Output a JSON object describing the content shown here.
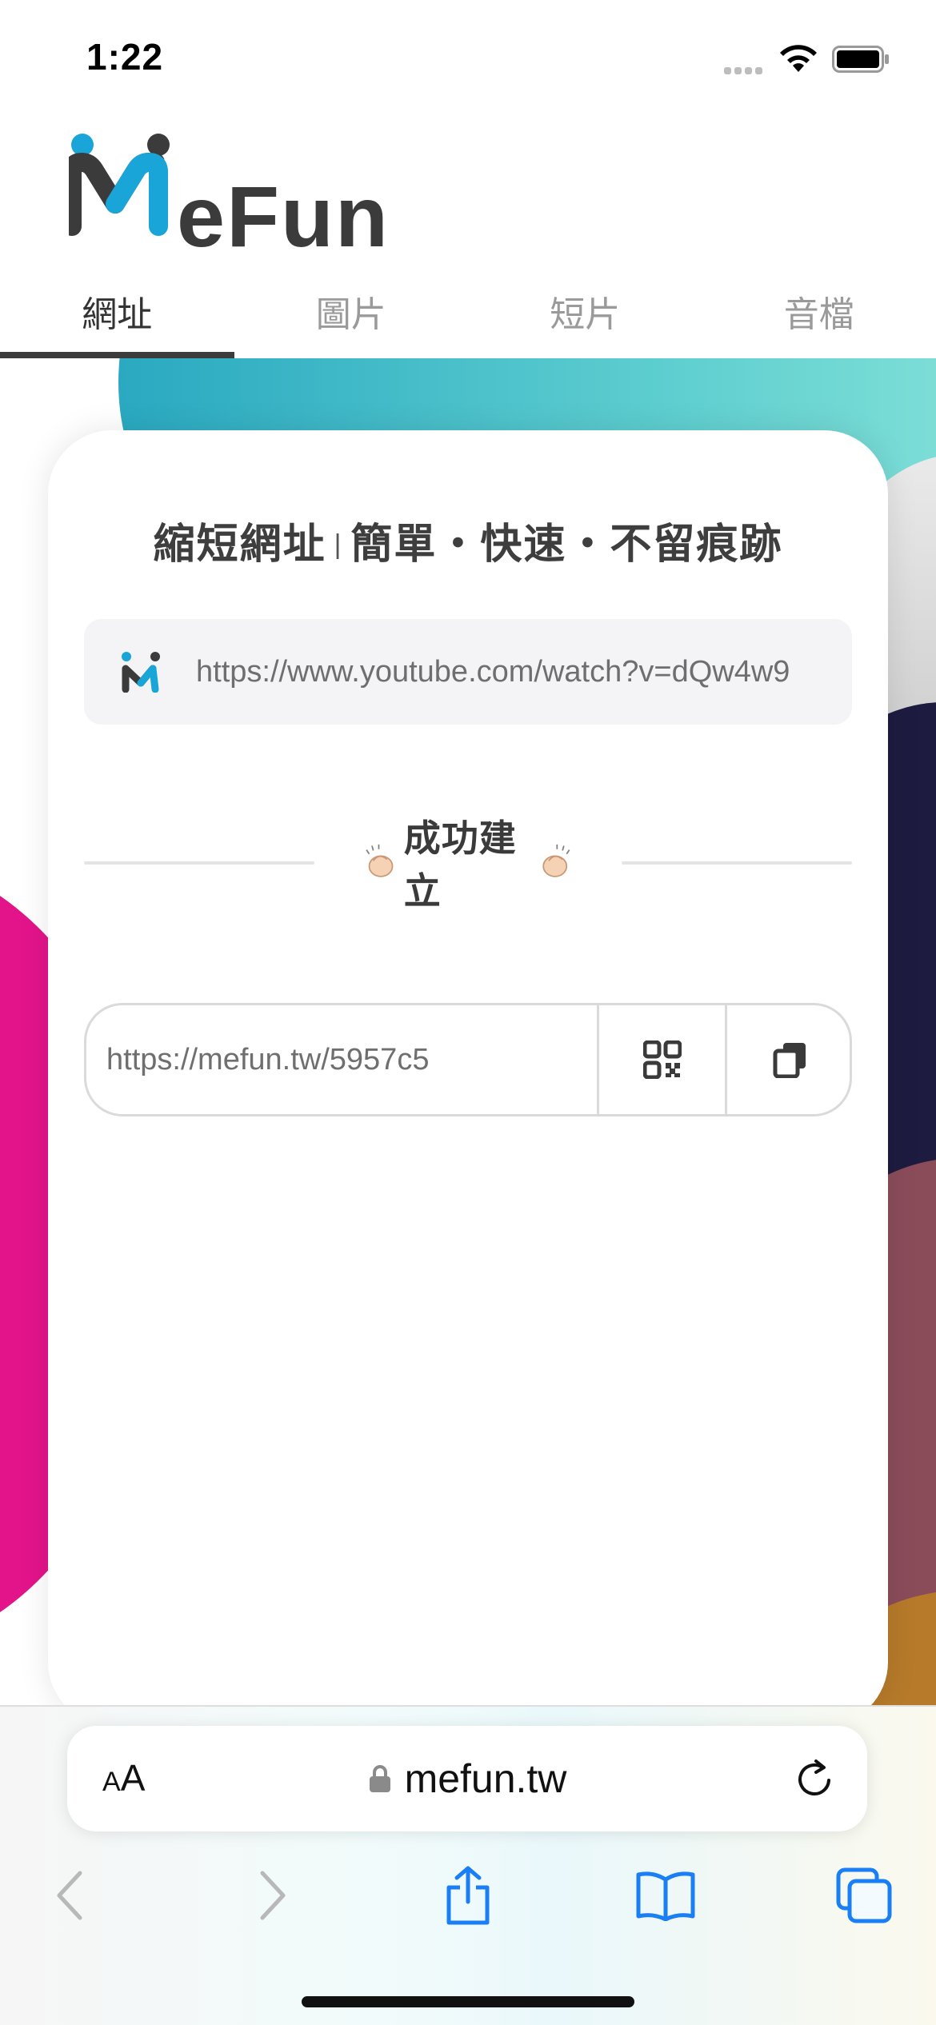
{
  "status_bar": {
    "time": "1:22"
  },
  "header": {
    "logo_text": "eFun",
    "logo_colors": {
      "accent": "#1aa5d8",
      "dark": "#3b3b3b"
    }
  },
  "tabs": [
    {
      "label": "網址",
      "active": true
    },
    {
      "label": "圖片",
      "active": false
    },
    {
      "label": "短片",
      "active": false
    },
    {
      "label": "音檔",
      "active": false
    }
  ],
  "card": {
    "title_part1": "縮短網址",
    "title_sep": "|",
    "title_part2": "簡單・快速・不留痕跡",
    "input_value": "https://www.youtube.com/watch?v=dQw4w9",
    "success_label": "成功建立",
    "success_emoji": "clapping-hands-icon",
    "short_url": "https://mefun.tw/5957c5",
    "qr_icon": "qr-code-icon",
    "copy_icon": "copy-icon"
  },
  "background_colors": {
    "teal": "#2aa9c1",
    "navy": "#1d1b3f",
    "pink": "#e3148a",
    "mauve": "#8b4c5a",
    "gold": "#b67a2a"
  },
  "safari": {
    "aa_small": "A",
    "aa_large": "A",
    "domain": "mefun.tw",
    "accent": "#1a7ef5",
    "toolbar_icons": [
      "back-icon",
      "forward-icon",
      "share-icon",
      "bookmarks-icon",
      "tabs-icon"
    ]
  }
}
